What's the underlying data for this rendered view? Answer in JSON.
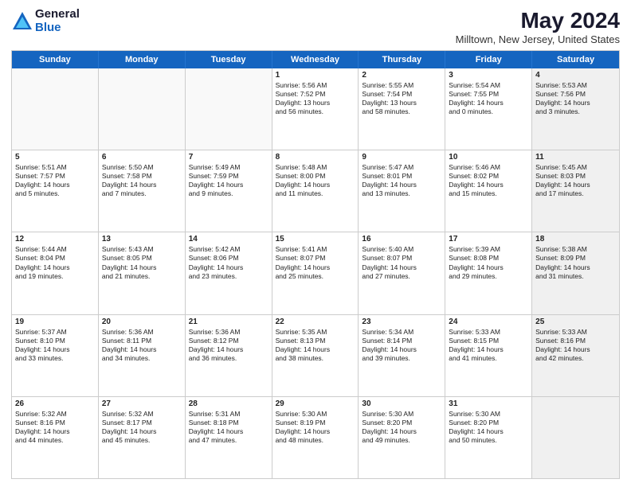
{
  "logo": {
    "general": "General",
    "blue": "Blue"
  },
  "title": "May 2024",
  "subtitle": "Milltown, New Jersey, United States",
  "days_of_week": [
    "Sunday",
    "Monday",
    "Tuesday",
    "Wednesday",
    "Thursday",
    "Friday",
    "Saturday"
  ],
  "weeks": [
    [
      {
        "day": "",
        "lines": [],
        "empty": true
      },
      {
        "day": "",
        "lines": [],
        "empty": true
      },
      {
        "day": "",
        "lines": [],
        "empty": true
      },
      {
        "day": "1",
        "lines": [
          "Sunrise: 5:56 AM",
          "Sunset: 7:52 PM",
          "Daylight: 13 hours",
          "and 56 minutes."
        ],
        "empty": false
      },
      {
        "day": "2",
        "lines": [
          "Sunrise: 5:55 AM",
          "Sunset: 7:54 PM",
          "Daylight: 13 hours",
          "and 58 minutes."
        ],
        "empty": false
      },
      {
        "day": "3",
        "lines": [
          "Sunrise: 5:54 AM",
          "Sunset: 7:55 PM",
          "Daylight: 14 hours",
          "and 0 minutes."
        ],
        "empty": false
      },
      {
        "day": "4",
        "lines": [
          "Sunrise: 5:53 AM",
          "Sunset: 7:56 PM",
          "Daylight: 14 hours",
          "and 3 minutes."
        ],
        "empty": false,
        "shaded": true
      }
    ],
    [
      {
        "day": "5",
        "lines": [
          "Sunrise: 5:51 AM",
          "Sunset: 7:57 PM",
          "Daylight: 14 hours",
          "and 5 minutes."
        ],
        "empty": false
      },
      {
        "day": "6",
        "lines": [
          "Sunrise: 5:50 AM",
          "Sunset: 7:58 PM",
          "Daylight: 14 hours",
          "and 7 minutes."
        ],
        "empty": false
      },
      {
        "day": "7",
        "lines": [
          "Sunrise: 5:49 AM",
          "Sunset: 7:59 PM",
          "Daylight: 14 hours",
          "and 9 minutes."
        ],
        "empty": false
      },
      {
        "day": "8",
        "lines": [
          "Sunrise: 5:48 AM",
          "Sunset: 8:00 PM",
          "Daylight: 14 hours",
          "and 11 minutes."
        ],
        "empty": false
      },
      {
        "day": "9",
        "lines": [
          "Sunrise: 5:47 AM",
          "Sunset: 8:01 PM",
          "Daylight: 14 hours",
          "and 13 minutes."
        ],
        "empty": false
      },
      {
        "day": "10",
        "lines": [
          "Sunrise: 5:46 AM",
          "Sunset: 8:02 PM",
          "Daylight: 14 hours",
          "and 15 minutes."
        ],
        "empty": false
      },
      {
        "day": "11",
        "lines": [
          "Sunrise: 5:45 AM",
          "Sunset: 8:03 PM",
          "Daylight: 14 hours",
          "and 17 minutes."
        ],
        "empty": false,
        "shaded": true
      }
    ],
    [
      {
        "day": "12",
        "lines": [
          "Sunrise: 5:44 AM",
          "Sunset: 8:04 PM",
          "Daylight: 14 hours",
          "and 19 minutes."
        ],
        "empty": false
      },
      {
        "day": "13",
        "lines": [
          "Sunrise: 5:43 AM",
          "Sunset: 8:05 PM",
          "Daylight: 14 hours",
          "and 21 minutes."
        ],
        "empty": false
      },
      {
        "day": "14",
        "lines": [
          "Sunrise: 5:42 AM",
          "Sunset: 8:06 PM",
          "Daylight: 14 hours",
          "and 23 minutes."
        ],
        "empty": false
      },
      {
        "day": "15",
        "lines": [
          "Sunrise: 5:41 AM",
          "Sunset: 8:07 PM",
          "Daylight: 14 hours",
          "and 25 minutes."
        ],
        "empty": false
      },
      {
        "day": "16",
        "lines": [
          "Sunrise: 5:40 AM",
          "Sunset: 8:07 PM",
          "Daylight: 14 hours",
          "and 27 minutes."
        ],
        "empty": false
      },
      {
        "day": "17",
        "lines": [
          "Sunrise: 5:39 AM",
          "Sunset: 8:08 PM",
          "Daylight: 14 hours",
          "and 29 minutes."
        ],
        "empty": false
      },
      {
        "day": "18",
        "lines": [
          "Sunrise: 5:38 AM",
          "Sunset: 8:09 PM",
          "Daylight: 14 hours",
          "and 31 minutes."
        ],
        "empty": false,
        "shaded": true
      }
    ],
    [
      {
        "day": "19",
        "lines": [
          "Sunrise: 5:37 AM",
          "Sunset: 8:10 PM",
          "Daylight: 14 hours",
          "and 33 minutes."
        ],
        "empty": false
      },
      {
        "day": "20",
        "lines": [
          "Sunrise: 5:36 AM",
          "Sunset: 8:11 PM",
          "Daylight: 14 hours",
          "and 34 minutes."
        ],
        "empty": false
      },
      {
        "day": "21",
        "lines": [
          "Sunrise: 5:36 AM",
          "Sunset: 8:12 PM",
          "Daylight: 14 hours",
          "and 36 minutes."
        ],
        "empty": false
      },
      {
        "day": "22",
        "lines": [
          "Sunrise: 5:35 AM",
          "Sunset: 8:13 PM",
          "Daylight: 14 hours",
          "and 38 minutes."
        ],
        "empty": false
      },
      {
        "day": "23",
        "lines": [
          "Sunrise: 5:34 AM",
          "Sunset: 8:14 PM",
          "Daylight: 14 hours",
          "and 39 minutes."
        ],
        "empty": false
      },
      {
        "day": "24",
        "lines": [
          "Sunrise: 5:33 AM",
          "Sunset: 8:15 PM",
          "Daylight: 14 hours",
          "and 41 minutes."
        ],
        "empty": false
      },
      {
        "day": "25",
        "lines": [
          "Sunrise: 5:33 AM",
          "Sunset: 8:16 PM",
          "Daylight: 14 hours",
          "and 42 minutes."
        ],
        "empty": false,
        "shaded": true
      }
    ],
    [
      {
        "day": "26",
        "lines": [
          "Sunrise: 5:32 AM",
          "Sunset: 8:16 PM",
          "Daylight: 14 hours",
          "and 44 minutes."
        ],
        "empty": false
      },
      {
        "day": "27",
        "lines": [
          "Sunrise: 5:32 AM",
          "Sunset: 8:17 PM",
          "Daylight: 14 hours",
          "and 45 minutes."
        ],
        "empty": false
      },
      {
        "day": "28",
        "lines": [
          "Sunrise: 5:31 AM",
          "Sunset: 8:18 PM",
          "Daylight: 14 hours",
          "and 47 minutes."
        ],
        "empty": false
      },
      {
        "day": "29",
        "lines": [
          "Sunrise: 5:30 AM",
          "Sunset: 8:19 PM",
          "Daylight: 14 hours",
          "and 48 minutes."
        ],
        "empty": false
      },
      {
        "day": "30",
        "lines": [
          "Sunrise: 5:30 AM",
          "Sunset: 8:20 PM",
          "Daylight: 14 hours",
          "and 49 minutes."
        ],
        "empty": false
      },
      {
        "day": "31",
        "lines": [
          "Sunrise: 5:30 AM",
          "Sunset: 8:20 PM",
          "Daylight: 14 hours",
          "and 50 minutes."
        ],
        "empty": false
      },
      {
        "day": "",
        "lines": [],
        "empty": true,
        "shaded": true
      }
    ]
  ]
}
